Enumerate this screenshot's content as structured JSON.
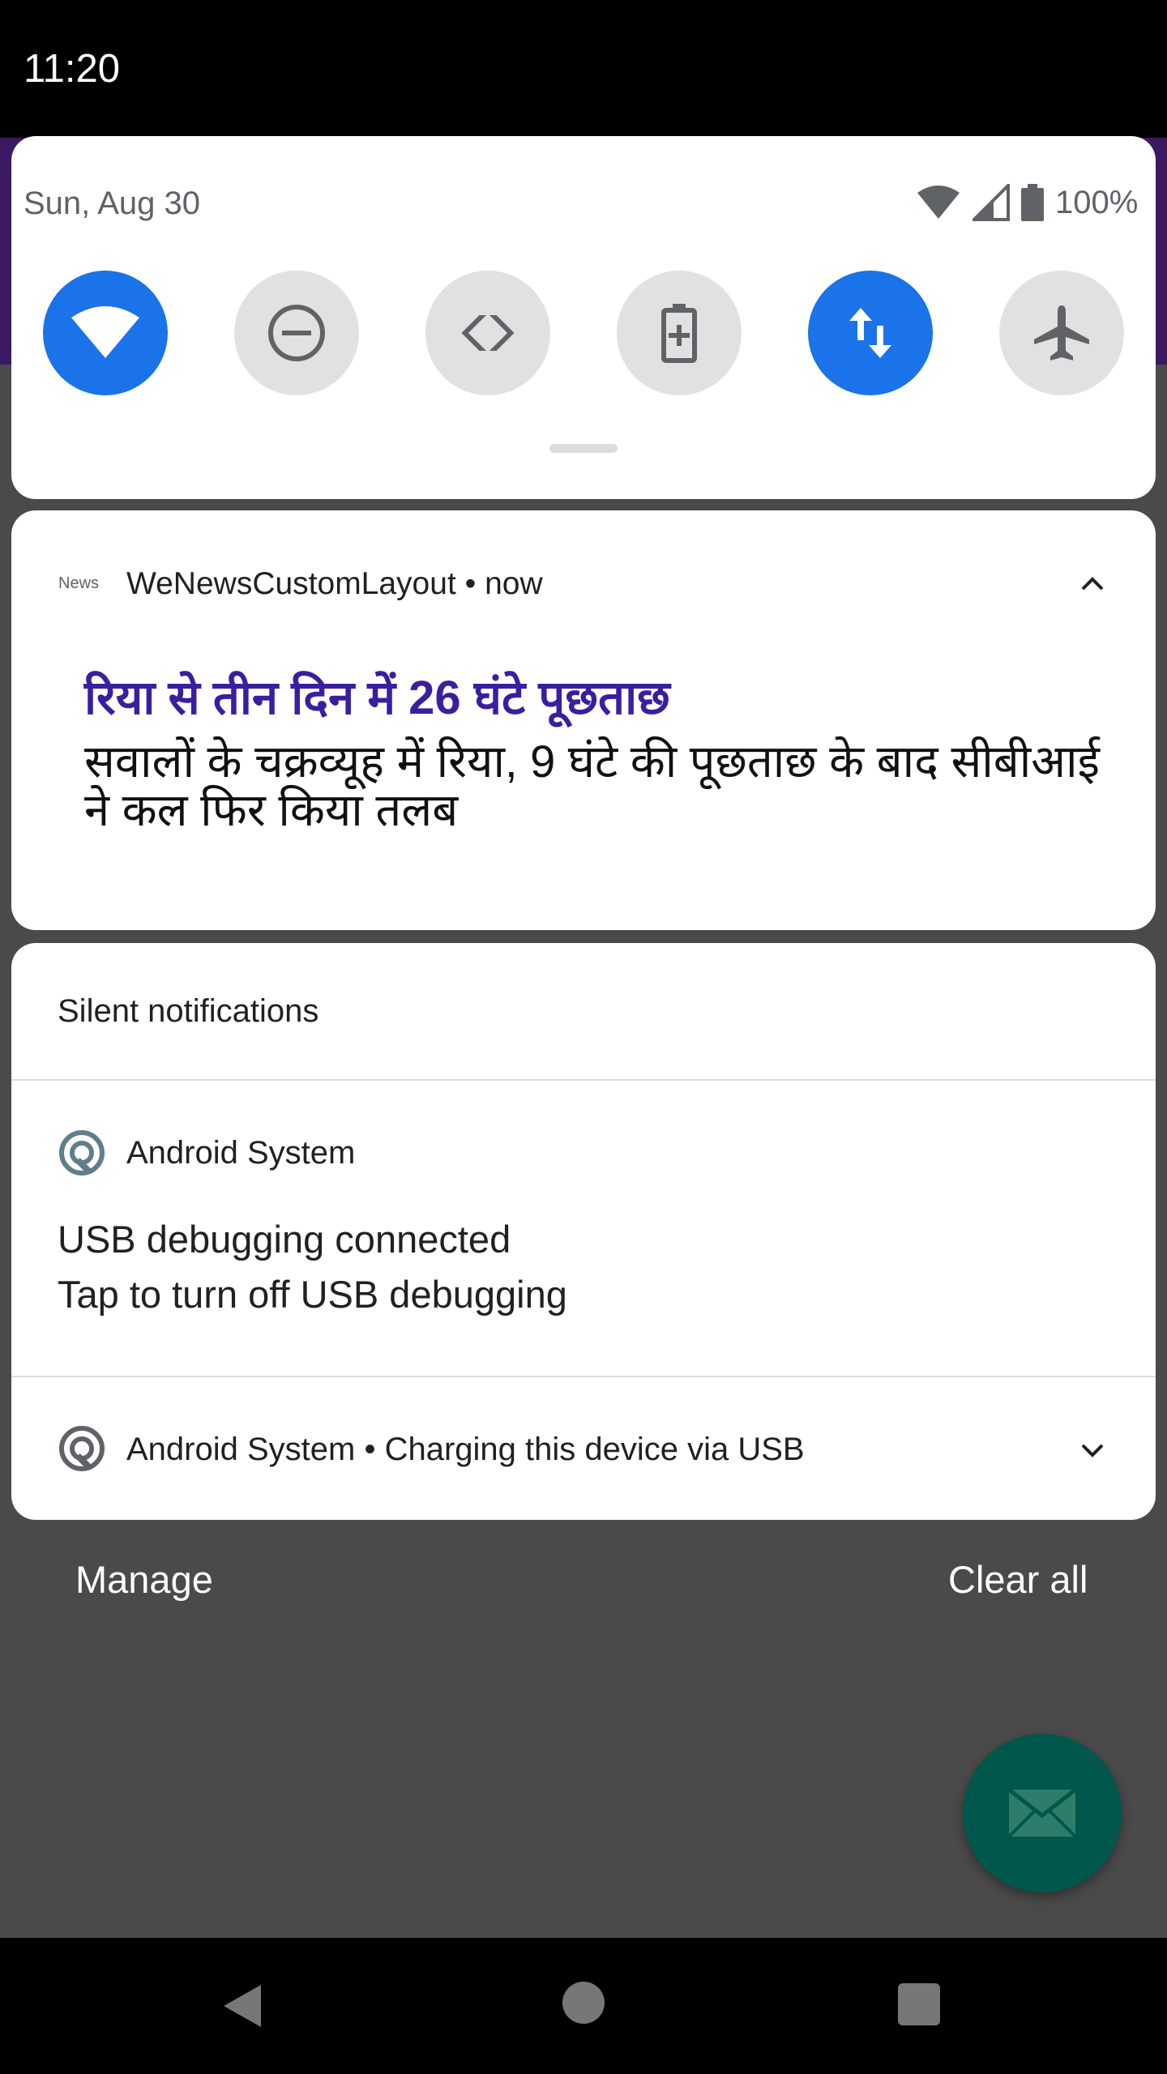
{
  "status_bar": {
    "time": "11:20"
  },
  "quick_settings": {
    "date": "Sun, Aug 30",
    "battery_percent": "100%",
    "accent_color": "#1a73e8",
    "tiles": [
      {
        "name": "wifi",
        "icon": "wifi-icon",
        "active": true
      },
      {
        "name": "do-not-disturb",
        "icon": "do-not-disturb-icon",
        "active": false
      },
      {
        "name": "auto-rotate",
        "icon": "auto-rotate-icon",
        "active": false
      },
      {
        "name": "battery-saver",
        "icon": "battery-saver-icon",
        "active": false
      },
      {
        "name": "mobile-data",
        "icon": "mobile-data-icon",
        "active": true
      },
      {
        "name": "airplane-mode",
        "icon": "airplane-icon",
        "active": false
      }
    ]
  },
  "news_notification": {
    "app_icon_label": "News",
    "header": "WeNewsCustomLayout • now",
    "headline": "रिया से तीन दिन में 26 घंटे पूछताछ",
    "body": "सवालों के चक्रव्यूह में रिया, 9 घंटे की पूछताछ के बाद सीबीआई ने कल फिर किया तलब",
    "headline_color": "#3b1ea0"
  },
  "silent_notifications": {
    "section_title": "Silent notifications",
    "usb_debugging": {
      "app_name": "Android System",
      "title": "USB debugging connected",
      "text": "Tap to turn off USB debugging"
    },
    "charging": {
      "line": "Android System • Charging this device via USB"
    }
  },
  "footer": {
    "manage_label": "Manage",
    "clear_all_label": "Clear all"
  },
  "fab": {
    "icon": "mail-icon",
    "color": "#00574b"
  },
  "nav_bar": {
    "back_icon": "back-icon",
    "home_icon": "home-icon",
    "recents_icon": "recents-icon"
  }
}
